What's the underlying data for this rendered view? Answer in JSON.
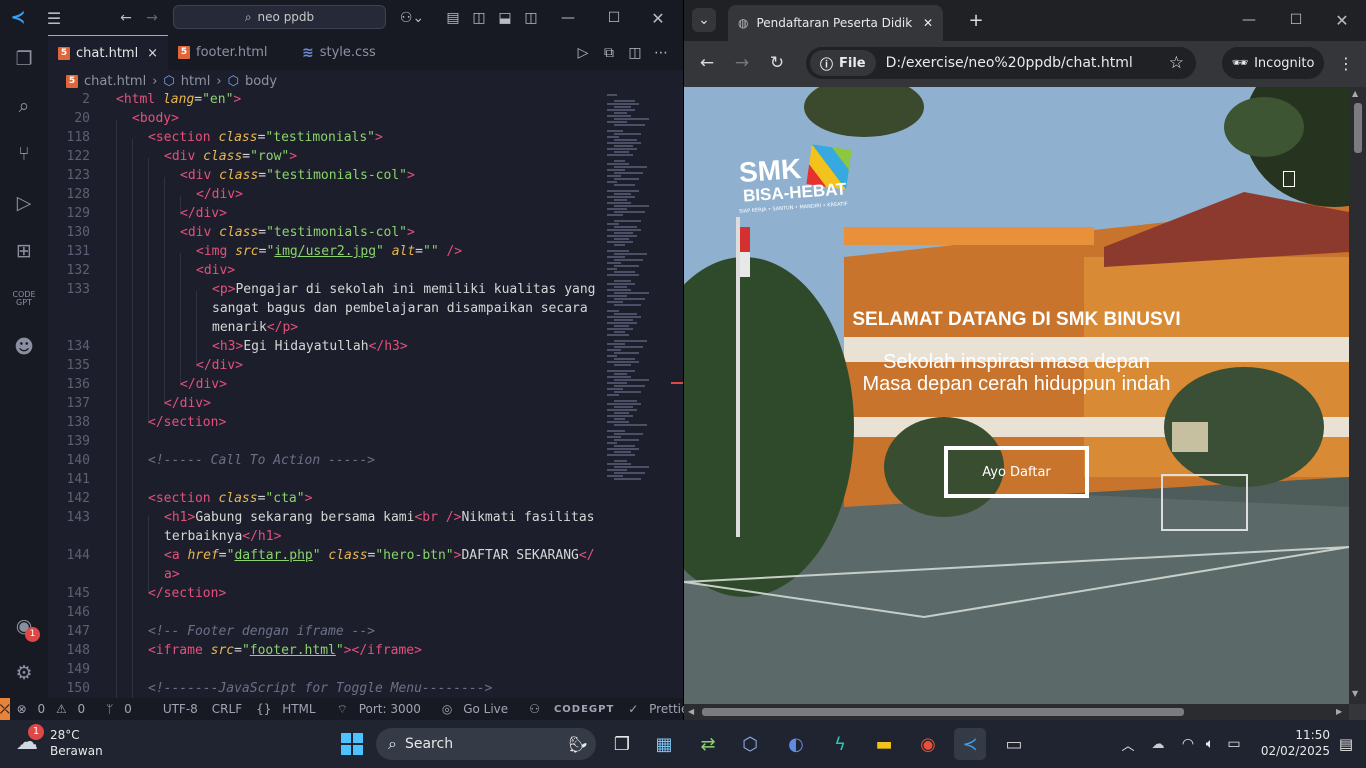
{
  "vscode": {
    "search_text": "neo ppdb",
    "tabs": [
      {
        "label": "chat.html",
        "close": "×"
      },
      {
        "label": "footer.html"
      },
      {
        "label": "style.css"
      }
    ],
    "breadcrumb": [
      "chat.html",
      "html",
      "body"
    ],
    "line_numbers": [
      "2",
      "20",
      "118",
      "122",
      "123",
      "128",
      "129",
      "130",
      "131",
      "132",
      "133",
      "",
      "",
      "134",
      "135",
      "136",
      "137",
      "138",
      "139",
      "140",
      "141",
      "142",
      "143",
      "",
      "144",
      "",
      "145",
      "146",
      "147",
      "148",
      "149",
      "150"
    ],
    "status": {
      "errors": "0",
      "warnings": "0",
      "ports": "0",
      "encoding": "UTF-8",
      "eol": "CRLF",
      "language": "HTML",
      "port": "Port: 3000",
      "golive": "Go Live",
      "codegpt": "CODEGPT",
      "prettier": "Prettier"
    },
    "activity": [
      "explorer-icon",
      "search-icon",
      "source-control-icon",
      "run-debug-icon",
      "extensions-icon",
      "codegpt-icon",
      "alien-icon",
      "account-icon",
      "settings-icon"
    ],
    "account_badge": "1"
  },
  "chrome": {
    "tab_title": "Pendaftaran Peserta Didik Baru",
    "file_chip": "File",
    "url": "D:/exercise/neo%20ppdb/chat.html",
    "incognito": "Incognito",
    "page": {
      "logo_line1": "SMK",
      "logo_line2": "BISA-HEBAT",
      "logo_tagline": "SIAP KERJA • SANTUN • MANDIRI • KREATIF",
      "heading": "SELAMAT DATANG DI SMK BINUSVI",
      "sub1": "Sekolah inspirasi masa depan",
      "sub2": "Masa depan cerah hiduppun indah",
      "button": "Ayo Daftar"
    }
  },
  "taskbar": {
    "weather_temp": "28°C",
    "weather_desc": "Berawan",
    "weather_badge": "1",
    "search": "Search",
    "time": "11:50",
    "date": "02/02/2025"
  }
}
